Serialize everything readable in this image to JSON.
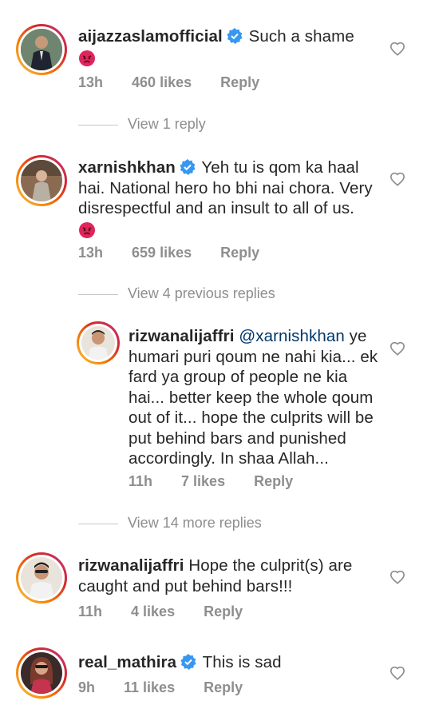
{
  "comments": [
    {
      "username": "aijazzaslamofficial",
      "verified": true,
      "text": "Such a shame",
      "emoji": "angry-face",
      "time": "13h",
      "likes": "460 likes",
      "reply": "Reply"
    },
    {
      "username": "xarnishkhan",
      "verified": true,
      "text": "Yeh tu is qom ka haal hai. National hero ho bhi nai chora. Very disrespectful and an insult to all of us.",
      "emoji": "angry-face",
      "time": "13h",
      "likes": "659 likes",
      "reply": "Reply"
    },
    {
      "username": "rizwanalijaffri",
      "verified": false,
      "mention": "@xarnishkhan",
      "text": "ye humari puri qoum ne nahi kia... ek fard ya group of people ne kia hai... better keep the whole qoum out of it... hope the culprits will be put behind bars and punished accordingly. In shaa Allah...",
      "time": "11h",
      "likes": "7 likes",
      "reply": "Reply"
    },
    {
      "username": "rizwanalijaffri",
      "verified": false,
      "text": "Hope the culprit(s) are caught and put behind bars!!!",
      "time": "11h",
      "likes": "4 likes",
      "reply": "Reply"
    },
    {
      "username": "real_mathira",
      "verified": true,
      "text": "This is sad",
      "time": "9h",
      "likes": "11 likes",
      "reply": "Reply"
    }
  ],
  "threads": {
    "view_1": "View 1 reply",
    "view_prev": "View 4 previous replies",
    "view_more": "View 14 more replies"
  },
  "colors": {
    "verified": "#3897f0",
    "secondary_text": "#8e8e8e",
    "mention": "#00376b",
    "angry_emoji": "#e0245e"
  }
}
